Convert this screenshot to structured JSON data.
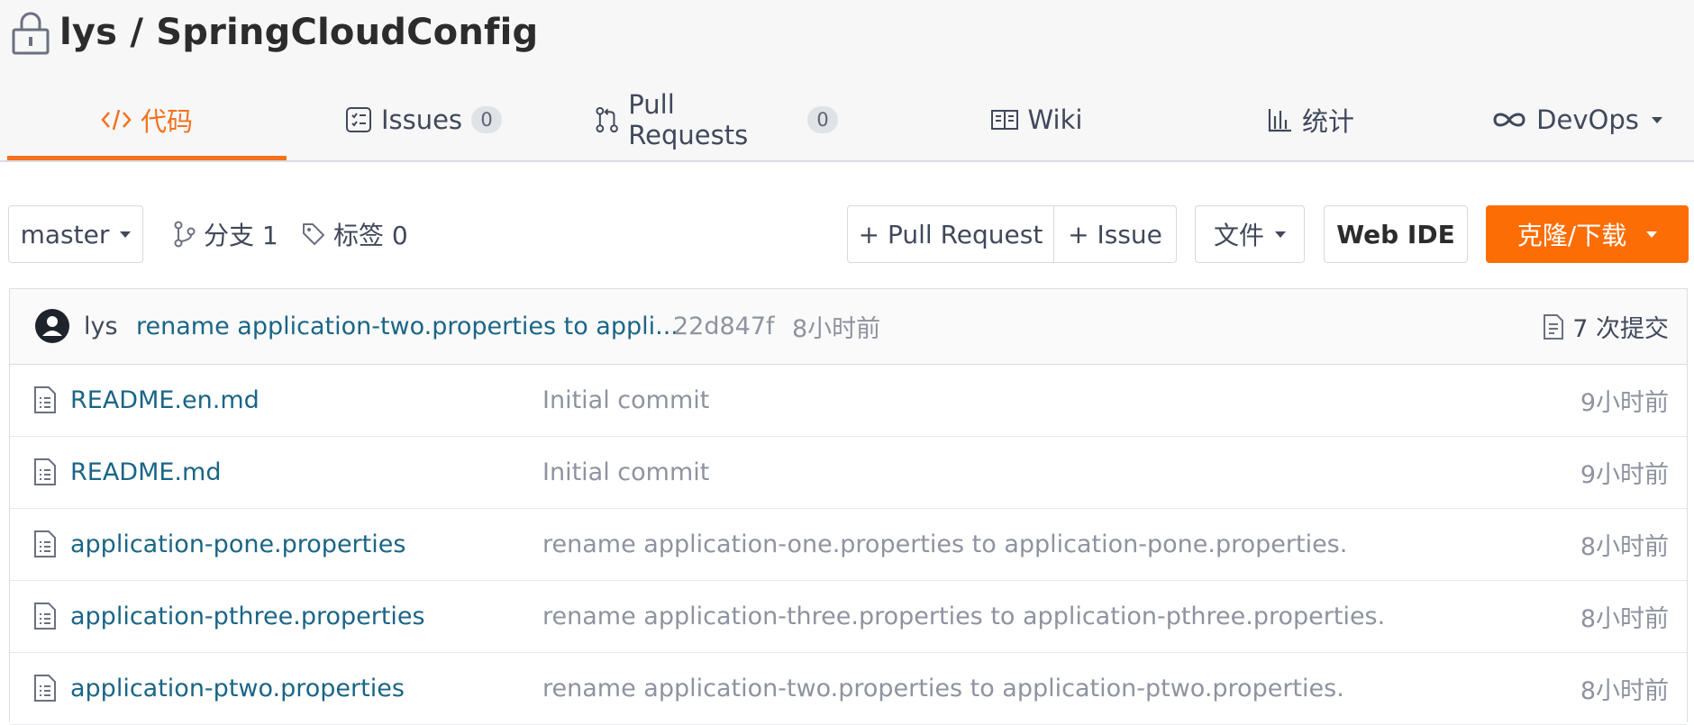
{
  "repo": {
    "owner": "lys",
    "separator": "/",
    "name": "SpringCloudConfig",
    "title": "lys / SpringCloudConfig"
  },
  "tabs": [
    {
      "label": "代码",
      "icon": "code-icon",
      "active": true
    },
    {
      "label": "Issues",
      "icon": "issues-icon",
      "count": "0"
    },
    {
      "label": "Pull Requests",
      "icon": "pull-request-icon",
      "count": "0"
    },
    {
      "label": "Wiki",
      "icon": "wiki-icon"
    },
    {
      "label": "统计",
      "icon": "stats-icon"
    },
    {
      "label": "DevOps",
      "icon": "infinity-icon"
    }
  ],
  "toolbar": {
    "branch_select": "master",
    "branches_label": "分支 1",
    "tags_label": "标签 0",
    "new_pr_label": "+ Pull Request",
    "new_issue_label": "+ Issue",
    "file_menu_label": "文件",
    "web_ide_label": "Web IDE",
    "clone_label": "克隆/下载"
  },
  "colors": {
    "accent": "#f4721f",
    "clone_button": "#fd6d05",
    "link": "#1a6587"
  },
  "latest_commit": {
    "author": "lys",
    "message": "rename application-two.properties to appli...",
    "hash": "22d847f",
    "time": "8小时前",
    "commits_label": "7 次提交"
  },
  "files": [
    {
      "name": "README.en.md",
      "message": "Initial commit",
      "time": "9小时前"
    },
    {
      "name": "README.md",
      "message": "Initial commit",
      "time": "9小时前"
    },
    {
      "name": "application-pone.properties",
      "message": "rename application-one.properties to application-pone.properties.",
      "time": "8小时前"
    },
    {
      "name": "application-pthree.properties",
      "message": "rename application-three.properties to application-pthree.properties.",
      "time": "8小时前"
    },
    {
      "name": "application-ptwo.properties",
      "message": "rename application-two.properties to application-ptwo.properties.",
      "time": "8小时前"
    }
  ]
}
